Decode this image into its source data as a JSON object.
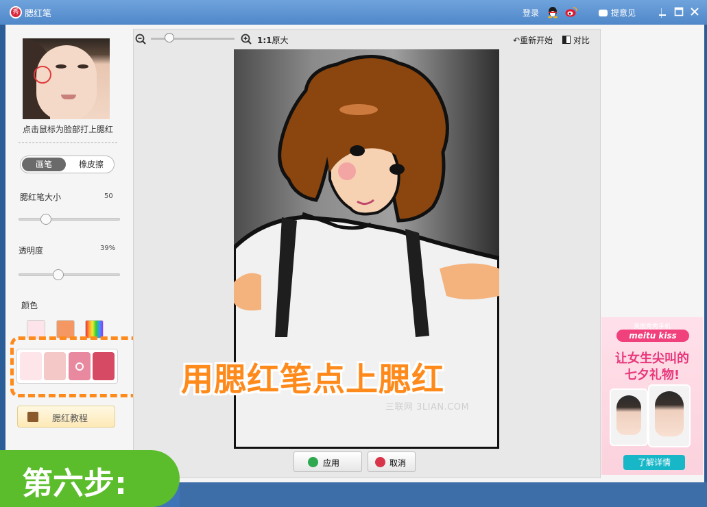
{
  "window": {
    "title": "腮红笔",
    "logo_char": "秀",
    "login": "登录",
    "feedback": "提意见"
  },
  "left_panel": {
    "hint": "点击鼠标为脸部打上腮红",
    "mode_tabs": [
      "画笔",
      "橡皮擦"
    ],
    "active_mode": "画笔",
    "brush_size_label": "腮红笔大小",
    "brush_size_value": "50",
    "brush_size_level": 0.27,
    "opacity_label": "透明度",
    "opacity_value": "39%",
    "opacity_level": 0.39,
    "color_label": "颜色",
    "color_swatches": [
      "#fde3ea",
      "#f59762",
      "rainbow"
    ],
    "palette": [
      "#fde5ea",
      "#f5c8c8",
      "#e889a0",
      "#d64a63"
    ],
    "selected_palette_index": 2,
    "tutorial_button": "腮红教程"
  },
  "canvas": {
    "zoom_ratio_bold": "1:1",
    "zoom_ratio_text": "原大",
    "reset_label": "重新开始",
    "compare_label": "对比",
    "watermark": "三联网 3LIAN.COM",
    "apply_label": "应用",
    "cancel_label": "取消"
  },
  "ad": {
    "subtitle": "美图秀秀手机",
    "brand": "meitu kiss",
    "headline_line1": "让女生尖叫的",
    "headline_line2": "七夕礼物!",
    "cta": "了解详情"
  },
  "overlay": {
    "caption": "用腮红笔点上腮红",
    "step": "第六步:"
  },
  "colors": {
    "titlebar": "#5b93d3",
    "overlay_text": "#ff8a1c",
    "step_badge": "#5cbd2c",
    "ad_pink": "#e8377a"
  }
}
